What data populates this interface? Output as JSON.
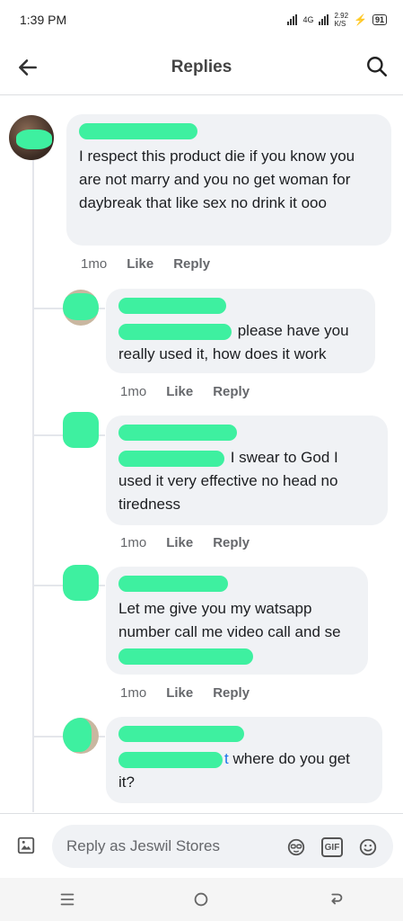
{
  "status_bar": {
    "time": "1:39 PM",
    "network": "4G",
    "speed": "2.92",
    "speed_unit": "K/S",
    "battery": "91"
  },
  "header": {
    "title": "Replies"
  },
  "comments": [
    {
      "text": "I respect this product die  if you know you are not marry and you no get woman for daybreak that like sex no drink it ooo",
      "time": "1mo",
      "like": "Like",
      "reply": "Reply"
    },
    {
      "tag_tail": "",
      "text": " please have you really used it, how does it work",
      "time": "1mo",
      "like": "Like",
      "reply": "Reply"
    },
    {
      "tag_tail": "",
      "text": " I swear to God I used it very effective no head no tiredness",
      "time": "1mo",
      "like": "Like",
      "reply": "Reply"
    },
    {
      "text": "Let me give you my watsapp number call me video call and se",
      "time": "1mo",
      "like": "Like",
      "reply": "Reply"
    },
    {
      "tag_tail": "t",
      "text": " where do you get it?",
      "time": "",
      "like": "",
      "reply": ""
    }
  ],
  "composer": {
    "placeholder": "Reply as Jeswil Stores",
    "gif_label": "GIF"
  },
  "colors": {
    "accent": "#1a73e8",
    "bubble": "#f0f2f5",
    "redaction": "#3ef0a0"
  }
}
